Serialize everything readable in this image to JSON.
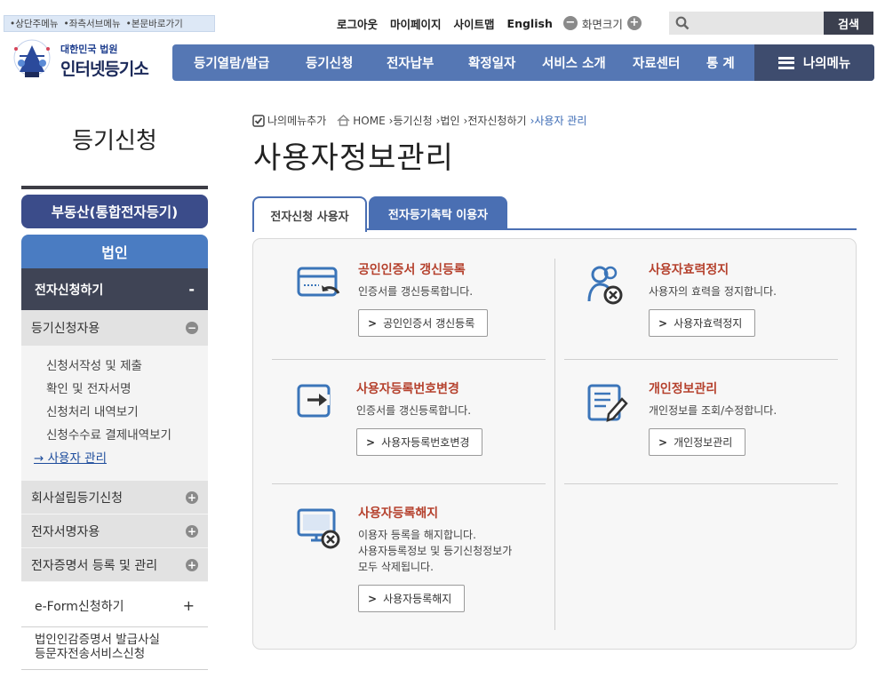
{
  "skip_links": [
    "•상단주메뉴",
    "•좌측서브메뉴",
    "•본문바로가기"
  ],
  "util": {
    "logout": "로그아웃",
    "mypage": "마이페이지",
    "sitemap": "사이트맵",
    "english": "English",
    "zoom_label": "화면크기",
    "zoom_minus": "−",
    "zoom_plus": "+"
  },
  "search": {
    "placeholder": "",
    "button": "검색"
  },
  "logo": {
    "line1": "대한민국 법원",
    "line2": "인터넷등기소"
  },
  "gnb": {
    "items": [
      "등기열람/발급",
      "등기신청",
      "전자납부",
      "확정일자",
      "서비스 소개",
      "자료센터",
      "통 계"
    ],
    "my_menu": "나의메뉴"
  },
  "lnb": {
    "title": "등기신청",
    "realestate": "부동산(통합전자등기)",
    "corporation": "법인",
    "depth2": "전자신청하기",
    "depth2_toggle": "-",
    "depth3": "등기신청자용",
    "depth3_toggle": "−",
    "subitems": [
      "신청서작성 및 제출",
      "확인 및 전자서명",
      "신청처리 내역보기",
      "신청수수료 결제내역보기",
      "→ 사용자 관리"
    ],
    "groups": [
      {
        "label": "회사설립등기신청",
        "toggle": "+"
      },
      {
        "label": "전자서명자용",
        "toggle": "+"
      },
      {
        "label": "전자증명서 등록 및 관리",
        "toggle": "+"
      }
    ],
    "eform": "e-Form신청하기",
    "eform_toggle": "+",
    "last_line1": "법인인감증명서 발급사실",
    "last_line2": "등문자전송서비스신청"
  },
  "breadcrumb": {
    "add_menu": "나의메뉴추가",
    "items": [
      "HOME",
      "›등기신청",
      "›법인",
      "›전자신청하기",
      "›사용자 관리"
    ]
  },
  "page_title": "사용자정보관리",
  "tabs": [
    "전자신청 사용자",
    "전자등기촉탁 이용자"
  ],
  "cards": [
    {
      "title": "공인인증서 갱신등록",
      "desc": [
        "인증서를 갱신등록합니다."
      ],
      "button": "공인인증서 갱신등록",
      "icon": "card-renew-icon"
    },
    {
      "title": "사용자효력정지",
      "desc": [
        "사용자의 효력을 정지합니다."
      ],
      "button": "사용자효력정지",
      "icon": "user-suspend-icon"
    },
    {
      "title": "사용자등록번호변경",
      "desc": [
        "인증서를 갱신등록합니다."
      ],
      "button": "사용자등록번호변경",
      "icon": "id-change-icon"
    },
    {
      "title": "개인정보관리",
      "desc": [
        "개인정보를 조회/수정합니다."
      ],
      "button": "개인정보관리",
      "icon": "document-edit-icon"
    },
    {
      "title": "사용자등록해지",
      "desc": [
        "이용자 등록을 해지합니다.",
        "사용자등록정보 및 등기신청정보가",
        "모두 삭제됩니다."
      ],
      "button": "사용자등록해지",
      "icon": "monitor-cancel-icon"
    }
  ],
  "button_arrow": ">",
  "colors": {
    "gnb": "#5577b4",
    "my_menu": "#3e4c6e",
    "title_red": "#b5412d",
    "lnb_dark": "#3f4455",
    "lnb_blue": "#4a7cc2"
  }
}
